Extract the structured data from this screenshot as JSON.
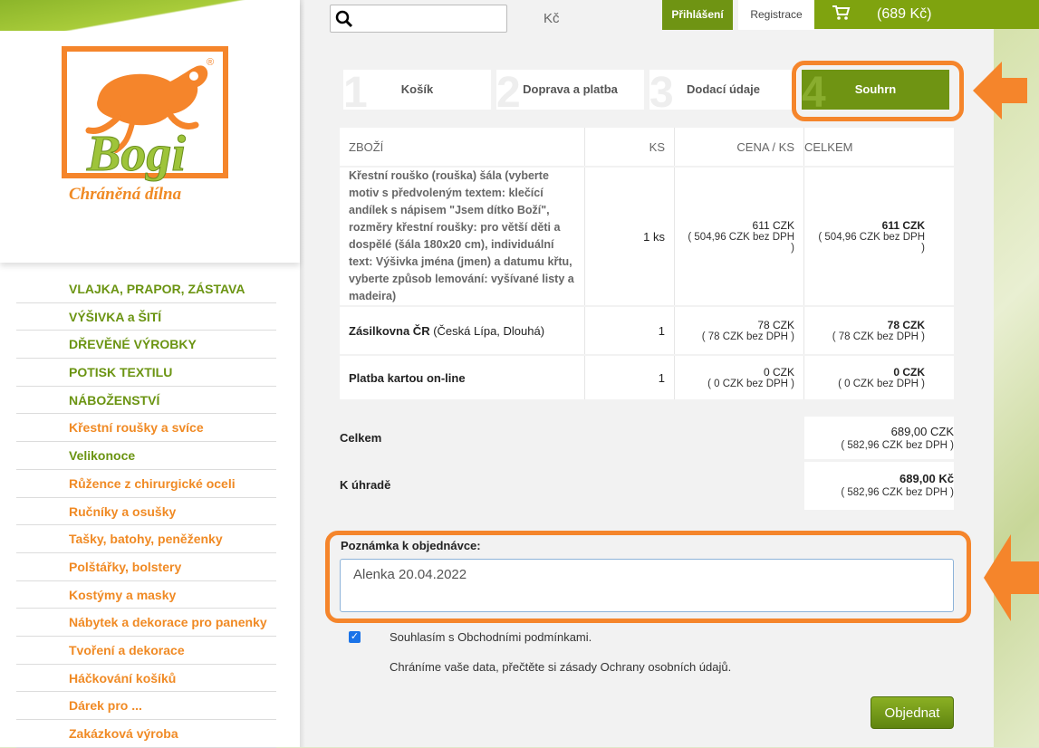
{
  "header": {
    "search_placeholder": "",
    "currency": "Kč",
    "login_label": "Přihlášení",
    "register_label": "Registrace",
    "cart_total": "(689 Kč)"
  },
  "logo": {
    "brand": "Bogi",
    "tagline": "Chráněná dílna",
    "registered": "®"
  },
  "nav": [
    {
      "label": "VLAJKA, PRAPOR, ZÁSTAVA",
      "color": "green"
    },
    {
      "label": "VÝŠIVKA a ŠITÍ",
      "color": "green"
    },
    {
      "label": "DŘEVĚNÉ VÝROBKY",
      "color": "green"
    },
    {
      "label": "POTISK TEXTILU",
      "color": "green"
    },
    {
      "label": "NÁBOŽENSTVÍ",
      "color": "green"
    },
    {
      "label": "Křestní roušky a svíce",
      "color": "orange"
    },
    {
      "label": "Velikonoce",
      "color": "green"
    },
    {
      "label": "Růžence z chirurgické oceli",
      "color": "orange"
    },
    {
      "label": "Ručníky a osušky",
      "color": "orange"
    },
    {
      "label": "Tašky, batohy, peněženky",
      "color": "orange"
    },
    {
      "label": "Polštářky, bolstery",
      "color": "orange"
    },
    {
      "label": "Kostýmy a masky",
      "color": "orange"
    },
    {
      "label": "Nábytek a dekorace pro panenky",
      "color": "orange"
    },
    {
      "label": "Tvoření a dekorace",
      "color": "orange"
    },
    {
      "label": "Háčkování košíků",
      "color": "orange"
    },
    {
      "label": "Dárek pro ...",
      "color": "orange"
    },
    {
      "label": "Zakázková výroba",
      "color": "orange"
    }
  ],
  "steps": [
    {
      "num": "1",
      "label": "Košík"
    },
    {
      "num": "2",
      "label": "Doprava a platba"
    },
    {
      "num": "3",
      "label": "Dodací údaje"
    },
    {
      "num": "4",
      "label": "Souhrn"
    }
  ],
  "table": {
    "headers": {
      "item": "ZBOŽÍ",
      "qty": "KS",
      "unit_price": "CENA / KS",
      "total": "CELKEM"
    },
    "rows": [
      {
        "item": "Křestní rouško (rouška) šála (vyberte motiv s předvoleným textem: klečící andílek s nápisem \"Jsem dítko Boží\", rozměry křestní roušky: pro větší děti a dospělé (šála 180x20 cm), individuální text: Výšivka jména (jmen) a datumu křtu, vyberte způsob lemování: vyšívané listy a madeira)",
        "qty": "1 ks",
        "unit_price": "611 CZK",
        "unit_price_net": "( 504,96 CZK bez DPH )",
        "total": "611 CZK",
        "total_net": "( 504,96 CZK bez DPH )"
      },
      {
        "item_bold": "Zásilkovna ČR",
        "item_rest": " (Česká Lípa, Dlouhá)",
        "qty": "1",
        "unit_price": "78 CZK",
        "unit_price_net": "( 78 CZK bez DPH )",
        "total": "78 CZK",
        "total_net": "( 78 CZK bez DPH )"
      },
      {
        "item_bold": "Platba kartou on-line",
        "qty": "1",
        "unit_price": "0 CZK",
        "unit_price_net": "( 0 CZK bez DPH )",
        "total": "0 CZK",
        "total_net": "( 0 CZK bez DPH )"
      }
    ]
  },
  "totals": {
    "total_label": "Celkem",
    "total_value": "689,00 CZK",
    "total_net": "( 582,96 CZK bez DPH )",
    "due_label": "K úhradě",
    "due_value": "689,00 Kč",
    "due_net": "( 582,96 CZK bez DPH )"
  },
  "note": {
    "label": "Poznámka k objednávce:",
    "value": "Alenka 20.04.2022"
  },
  "agree_label": "Souhlasím s Obchodními podmínkami.",
  "agree_checked": true,
  "privacy_text": "Chráníme vaše data, přečtěte si zásady Ochrany osobních údajů.",
  "order_button": "Objednat",
  "colors": {
    "green": "#6f9413",
    "orange": "#f08a24",
    "highlight": "#f5852b"
  }
}
